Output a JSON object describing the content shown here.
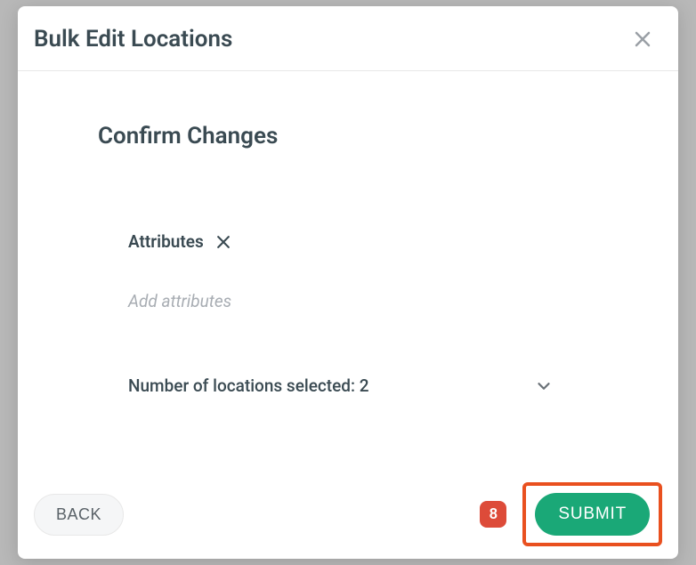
{
  "modal": {
    "title": "Bulk Edit Locations",
    "subtitle": "Confirm Changes",
    "attribute_label": "Attributes",
    "attribute_placeholder": "Add attributes",
    "selected_count_label": "Number of locations selected: 2",
    "back_label": "BACK",
    "submit_label": "SUBMIT",
    "badge_value": "8"
  }
}
